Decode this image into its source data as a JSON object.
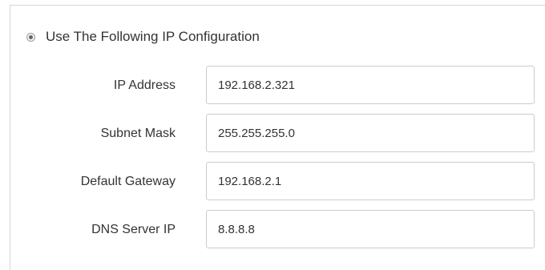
{
  "ip_config": {
    "mode_option": {
      "label": "Use The Following IP Configuration",
      "selected": true
    },
    "fields": [
      {
        "label": "IP Address",
        "value": "192.168.2.321"
      },
      {
        "label": "Subnet Mask",
        "value": "255.255.255.0"
      },
      {
        "label": "Default Gateway",
        "value": "192.168.2.1"
      },
      {
        "label": "DNS Server IP",
        "value": "8.8.8.8"
      }
    ]
  }
}
